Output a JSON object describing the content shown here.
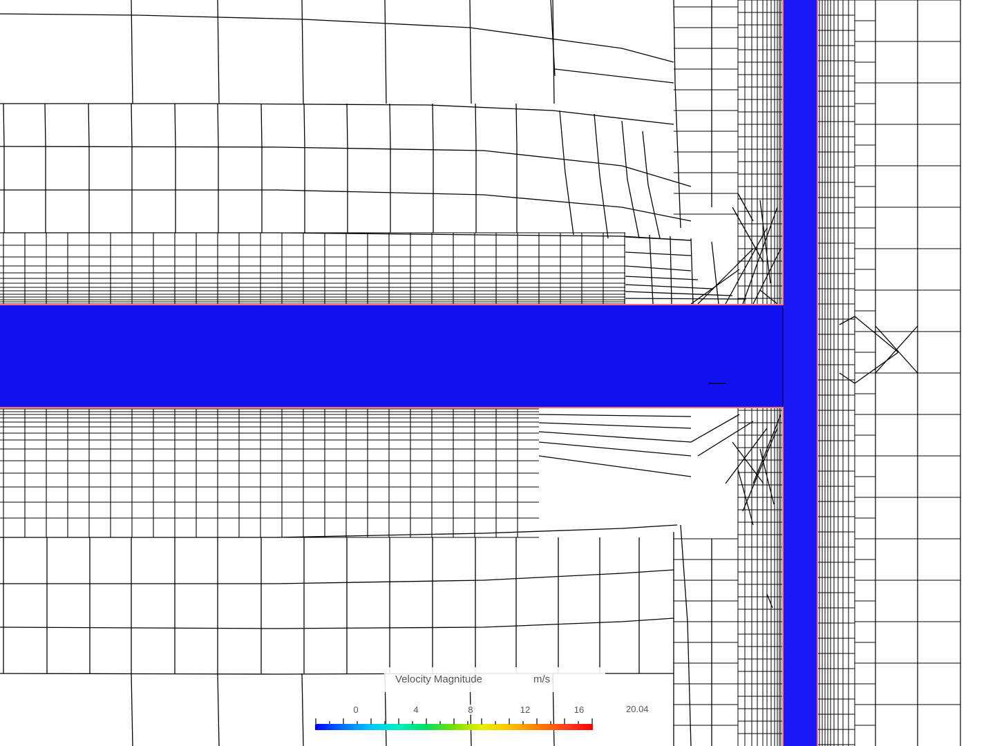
{
  "legend": {
    "title": "Velocity Magnitude",
    "unit": "m/s",
    "ticks": [
      "0",
      "4",
      "8",
      "12",
      "16"
    ],
    "max_label": "20.04",
    "colormap": [
      "#0000ff",
      "#0072ff",
      "#00c8ff",
      "#00f0c0",
      "#00e060",
      "#7ce000",
      "#e8f000",
      "#ffc000",
      "#ff8000",
      "#ff4020",
      "#ff0000"
    ]
  },
  "colors": {
    "pipe_fill": "#1010f0",
    "pipe_fill_vertical": "#1a1af8",
    "wall_highlight": "#ff7070",
    "mesh_line": "#000000",
    "background": "#ffffff"
  }
}
